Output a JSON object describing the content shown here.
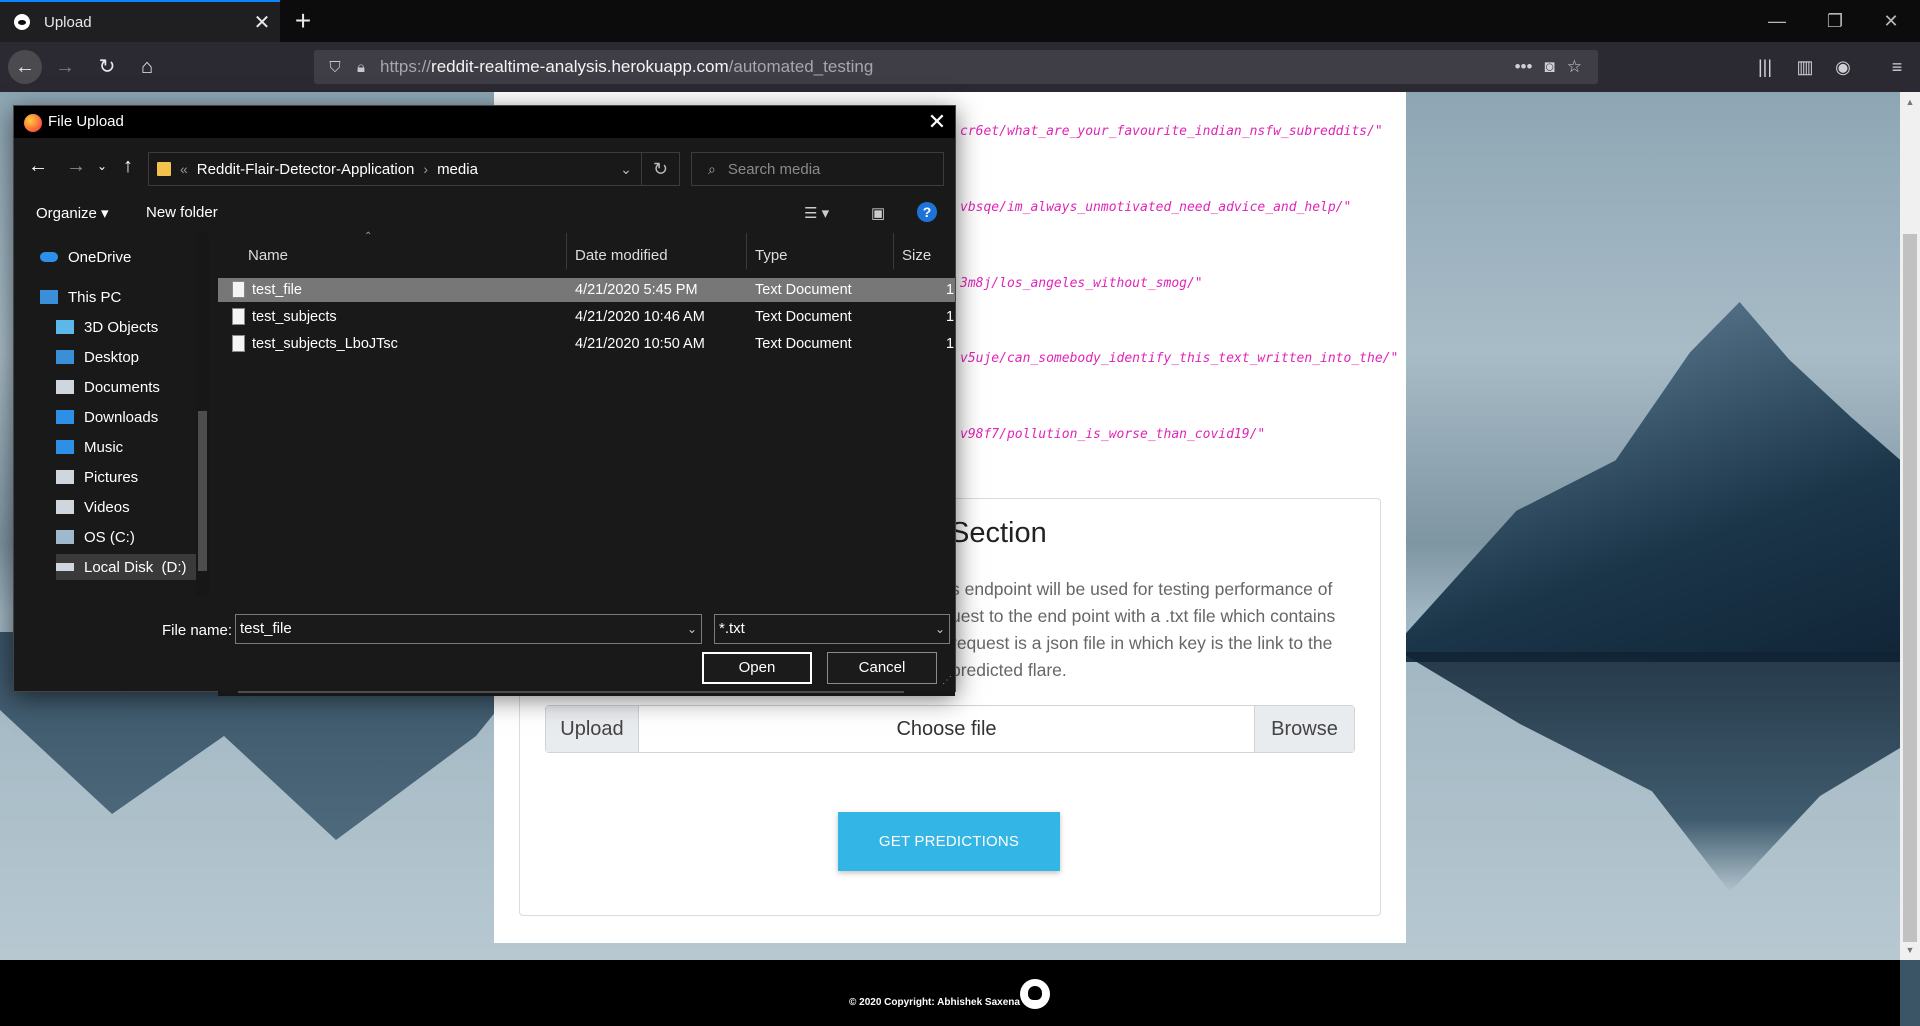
{
  "browser": {
    "tab_title": "Upload",
    "tab_close": "✕",
    "new_tab": "+",
    "url_prefix": "https://",
    "url_domain": "reddit-realtime-analysis.herokuapp.com",
    "url_path": "/automated_testing"
  },
  "page": {
    "links": [
      "cr6et/what_are_your_favourite_indian_nsfw_subreddits/\"",
      "vbsqe/im_always_unmotivated_need_advice_and_help/\"",
      "3m8j/los_angeles_without_smog/\"",
      "v5uje/can_somebody_identify_this_text_written_into_the/\"",
      "v98f7/pollution_is_worse_than_covid19/\""
    ],
    "card_title": "Section",
    "card_desc_lines": [
      "s endpoint will be used for testing performance of",
      "uest to the end point with a .txt file which contains",
      " request is a json file in which key is the link to the",
      "predicted flare."
    ],
    "upload_prefix": "Upload",
    "upload_placeholder": "Choose file",
    "upload_browse": "Browse",
    "predict_button": "GET PREDICTIONS",
    "footer_text": "© 2020 Copyright: Abhishek Saxena"
  },
  "dialog": {
    "title": "File Upload",
    "close": "✕",
    "breadcrumb_root": "«",
    "breadcrumb": [
      "Reddit-Flair-Detector-Application",
      "media"
    ],
    "search_placeholder": "Search media",
    "organize": "Organize ▾",
    "new_folder": "New folder",
    "help": "?",
    "sidebar": [
      {
        "label": "OneDrive",
        "icon": "cloud-icon",
        "color": "#2d8fe8"
      },
      {
        "label": "This PC",
        "icon": "computer-icon",
        "color": "#3a8fd8"
      },
      {
        "label": "3D Objects",
        "icon": "cube-icon",
        "color": "#5bb8e8"
      },
      {
        "label": "Desktop",
        "icon": "desktop-icon",
        "color": "#3a8fd8"
      },
      {
        "label": "Documents",
        "icon": "documents-icon",
        "color": "#cfd6de"
      },
      {
        "label": "Downloads",
        "icon": "download-icon",
        "color": "#2d8fe8"
      },
      {
        "label": "Music",
        "icon": "music-icon",
        "color": "#2d8fe8"
      },
      {
        "label": "Pictures",
        "icon": "pictures-icon",
        "color": "#cfd6de"
      },
      {
        "label": "Videos",
        "icon": "videos-icon",
        "color": "#cfd6de"
      },
      {
        "label": "OS (C:)",
        "icon": "drive-icon",
        "color": "#9fb8cc"
      },
      {
        "label": "Local Disk  (D:)",
        "icon": "disk-icon",
        "color": "#cfd6de"
      }
    ],
    "columns": {
      "name": "Name",
      "date": "Date modified",
      "type": "Type",
      "size": "Size"
    },
    "files": [
      {
        "name": "test_file",
        "date": "4/21/2020 5:45 PM",
        "type": "Text Document",
        "size": "1"
      },
      {
        "name": "test_subjects",
        "date": "4/21/2020 10:46 AM",
        "type": "Text Document",
        "size": "1"
      },
      {
        "name": "test_subjects_LboJTsc",
        "date": "4/21/2020 10:50 AM",
        "type": "Text Document",
        "size": "1"
      }
    ],
    "file_name_label": "File name:",
    "file_name_value": "test_file",
    "file_type": "*.txt",
    "open": "Open",
    "cancel": "Cancel"
  }
}
